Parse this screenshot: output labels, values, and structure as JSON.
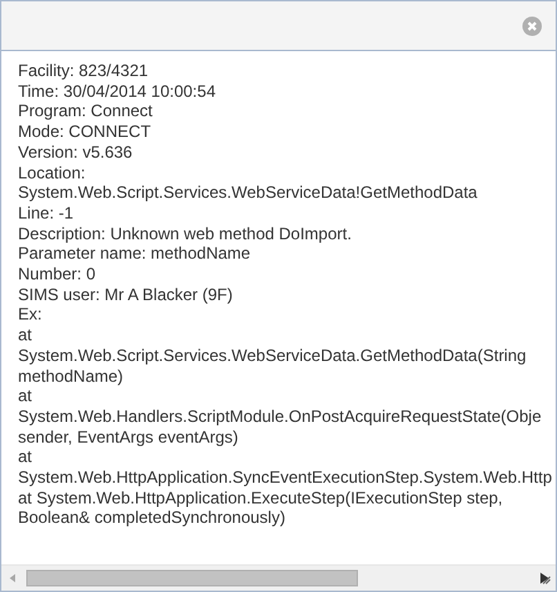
{
  "lines": [
    "Facility: 823/4321",
    "Time: 30/04/2014 10:00:54",
    "Program: Connect",
    "Mode: CONNECT",
    "Version: v5.636",
    "Location:",
    "System.Web.Script.Services.WebServiceData!GetMethodData",
    "Line: -1",
    "Description: Unknown web method DoImport.",
    "Parameter name: methodName",
    "Number: 0",
    "SIMS user: Mr A Blacker (9F)",
    "Ex:",
    "at",
    "System.Web.Script.Services.WebServiceData.GetMethodData(String",
    "methodName)",
    "at",
    "System.Web.Handlers.ScriptModule.OnPostAcquireRequestState(Obje",
    "sender, EventArgs eventArgs)",
    "at",
    "System.Web.HttpApplication.SyncEventExecutionStep.System.Web.Http",
    "at System.Web.HttpApplication.ExecuteStep(IExecutionStep step,",
    "Boolean& completedSynchronously)"
  ]
}
